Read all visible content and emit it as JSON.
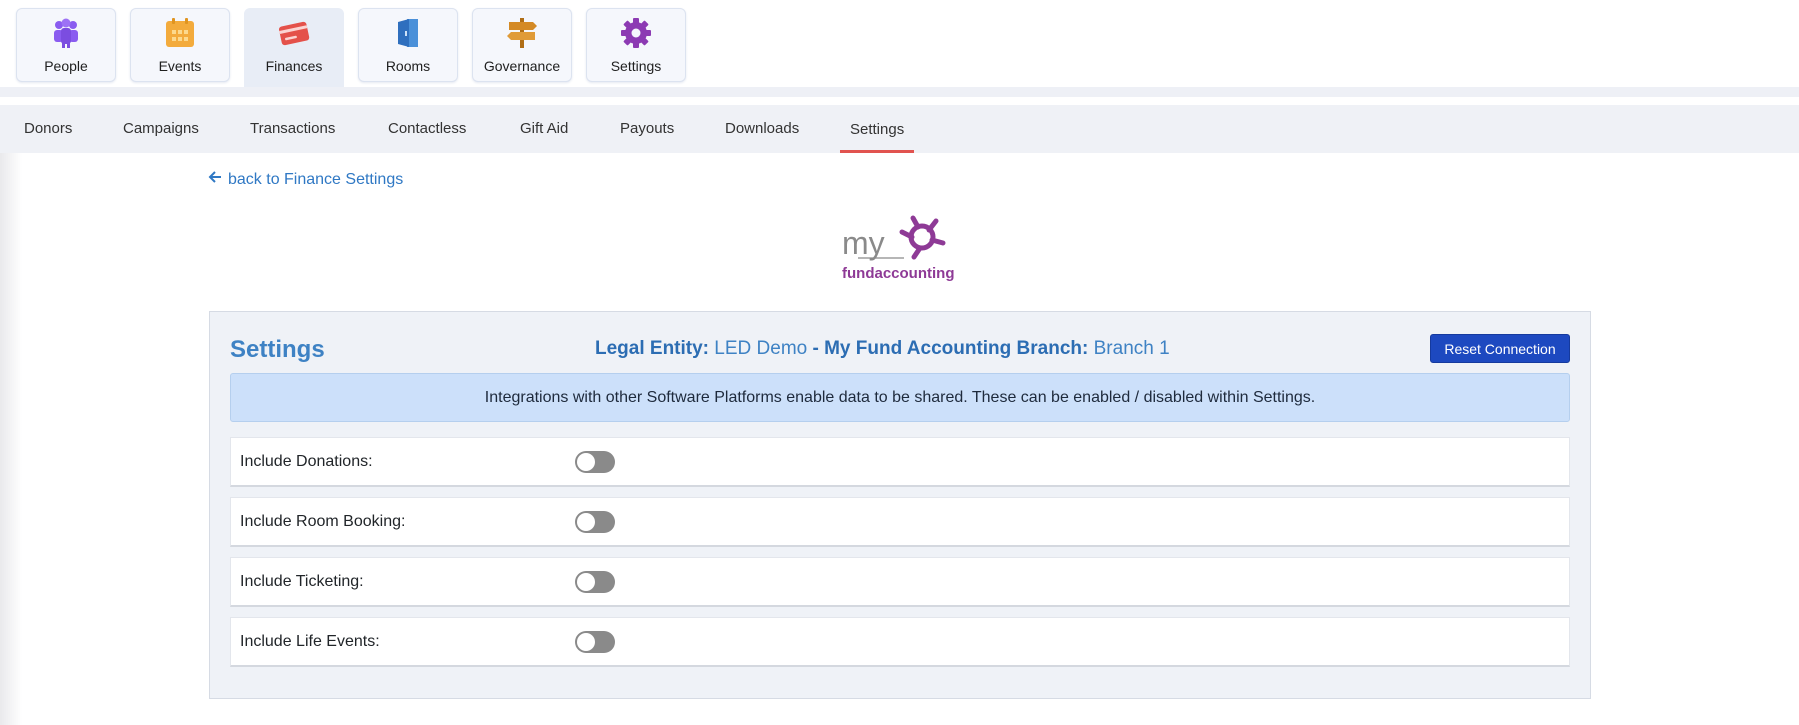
{
  "modules": [
    {
      "label": "People",
      "icon": "people-icon",
      "color": "#8a5cf0",
      "active": false
    },
    {
      "label": "Events",
      "icon": "calendar-icon",
      "color": "#f3ab3c",
      "active": false
    },
    {
      "label": "Finances",
      "icon": "credit-card-icon",
      "color": "#e4514a",
      "active": true
    },
    {
      "label": "Rooms",
      "icon": "door-icon",
      "color": "#4a90d9",
      "active": false
    },
    {
      "label": "Governance",
      "icon": "signpost-icon",
      "color": "#d48a25",
      "active": false
    },
    {
      "label": "Settings",
      "icon": "gear-icon",
      "color": "#8c3ab3",
      "active": false
    }
  ],
  "subtabs": [
    {
      "label": "Donors",
      "active": false
    },
    {
      "label": "Campaigns",
      "active": false
    },
    {
      "label": "Transactions",
      "active": false
    },
    {
      "label": "Contactless",
      "active": false
    },
    {
      "label": "Gift Aid",
      "active": false
    },
    {
      "label": "Payouts",
      "active": false
    },
    {
      "label": "Downloads",
      "active": false
    },
    {
      "label": "Settings",
      "active": true
    }
  ],
  "back_link": "back to Finance Settings",
  "logo": {
    "word_top": "my",
    "word_bottom": "fundaccounting",
    "color": "#8e3a96"
  },
  "panel": {
    "title": "Settings",
    "entity_label": "Legal Entity:",
    "entity_value": "LED Demo",
    "branch_label": "- My Fund Accounting Branch:",
    "branch_value": "Branch 1",
    "reset_label": "Reset Connection",
    "info": "Integrations with other Software Platforms enable data to be shared. These can be enabled / disabled within Settings.",
    "options": [
      {
        "label": "Include Donations:",
        "enabled": false
      },
      {
        "label": "Include Room Booking:",
        "enabled": false
      },
      {
        "label": "Include Ticketing:",
        "enabled": false
      },
      {
        "label": "Include Life Events:",
        "enabled": false
      }
    ]
  },
  "colors": {
    "accent": "#3e82c4",
    "button": "#1d49c0",
    "active_tab": "#e1534f",
    "info_bg": "#cce0fa"
  }
}
